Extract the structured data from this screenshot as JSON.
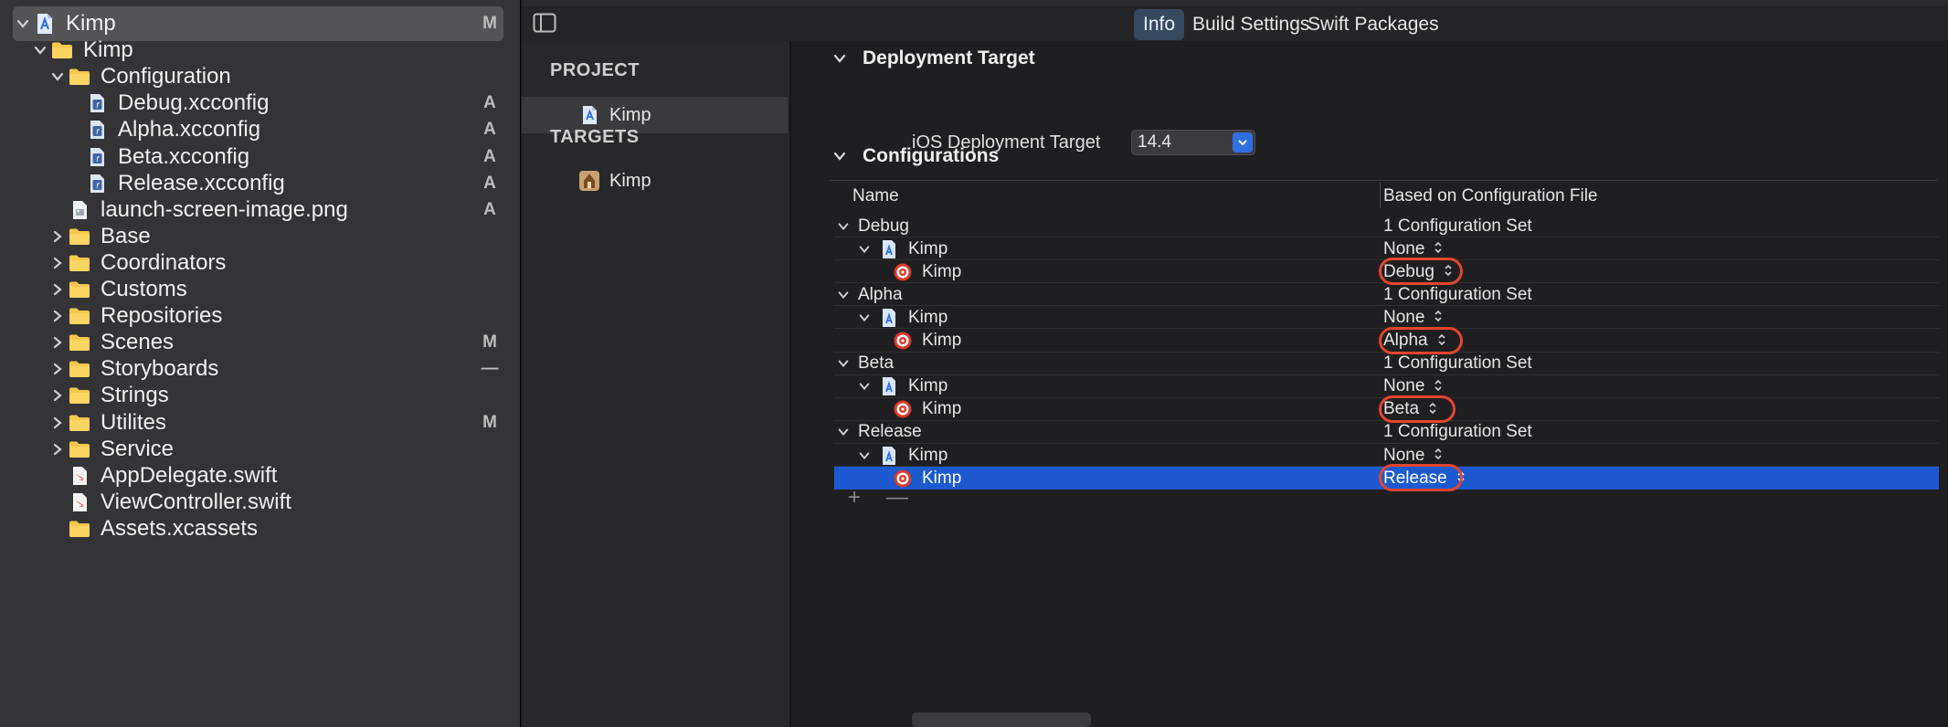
{
  "navigator": {
    "items": [
      {
        "label": "Kimp",
        "badge": "M",
        "kind": "project",
        "indent": 0,
        "disclosure": "open",
        "selected": true
      },
      {
        "label": "Kimp",
        "badge": "",
        "kind": "folder",
        "indent": 1,
        "disclosure": "open"
      },
      {
        "label": "Configuration",
        "badge": "",
        "kind": "folder",
        "indent": 2,
        "disclosure": "open"
      },
      {
        "label": "Debug.xcconfig",
        "badge": "A",
        "kind": "xcconfig",
        "indent": 3
      },
      {
        "label": "Alpha.xcconfig",
        "badge": "A",
        "kind": "xcconfig",
        "indent": 3
      },
      {
        "label": "Beta.xcconfig",
        "badge": "A",
        "kind": "xcconfig",
        "indent": 3
      },
      {
        "label": "Release.xcconfig",
        "badge": "A",
        "kind": "xcconfig",
        "indent": 3
      },
      {
        "label": "launch-screen-image.png",
        "badge": "A",
        "kind": "image",
        "indent": 2
      },
      {
        "label": "Base",
        "badge": "",
        "kind": "folder",
        "indent": 2,
        "disclosure": "closed"
      },
      {
        "label": "Coordinators",
        "badge": "",
        "kind": "folder",
        "indent": 2,
        "disclosure": "closed"
      },
      {
        "label": "Customs",
        "badge": "",
        "kind": "folder",
        "indent": 2,
        "disclosure": "closed"
      },
      {
        "label": "Repositories",
        "badge": "",
        "kind": "folder",
        "indent": 2,
        "disclosure": "closed"
      },
      {
        "label": "Scenes",
        "badge": "M",
        "kind": "folder",
        "indent": 2,
        "disclosure": "closed"
      },
      {
        "label": "Storyboards",
        "badge": "—",
        "kind": "folder",
        "indent": 2,
        "disclosure": "closed"
      },
      {
        "label": "Strings",
        "badge": "",
        "kind": "folder",
        "indent": 2,
        "disclosure": "closed"
      },
      {
        "label": "Utilites",
        "badge": "M",
        "kind": "folder",
        "indent": 2,
        "disclosure": "closed"
      },
      {
        "label": "Service",
        "badge": "",
        "kind": "folder",
        "indent": 2,
        "disclosure": "closed"
      },
      {
        "label": "AppDelegate.swift",
        "badge": "",
        "kind": "swift",
        "indent": 2
      },
      {
        "label": "ViewController.swift",
        "badge": "",
        "kind": "swift",
        "indent": 2
      },
      {
        "label": "Assets.xcassets",
        "badge": "",
        "kind": "folder",
        "indent": 2
      }
    ]
  },
  "tabs": {
    "info": "Info",
    "build_settings": "Build Settings",
    "swift_packages": "Swift Packages"
  },
  "project_list": {
    "project_header": "PROJECT",
    "project_item": "Kimp",
    "targets_header": "TARGETS",
    "target_item": "Kimp"
  },
  "deployment": {
    "header": "Deployment Target",
    "label": "iOS Deployment Target",
    "value": "14.4"
  },
  "configurations": {
    "header": "Configurations",
    "col_name": "Name",
    "col_file": "Based on Configuration File",
    "rows": [
      {
        "name": "Debug",
        "level": 0,
        "value": "1 Configuration Set"
      },
      {
        "name": "Kimp",
        "level": 1,
        "value": "None"
      },
      {
        "name": "Kimp",
        "level": 2,
        "value": "Debug",
        "circled": true
      },
      {
        "name": "Alpha",
        "level": 0,
        "value": "1 Configuration Set"
      },
      {
        "name": "Kimp",
        "level": 1,
        "value": "None"
      },
      {
        "name": "Kimp",
        "level": 2,
        "value": "Alpha",
        "circled": true
      },
      {
        "name": "Beta",
        "level": 0,
        "value": "1 Configuration Set"
      },
      {
        "name": "Kimp",
        "level": 1,
        "value": "None"
      },
      {
        "name": "Kimp",
        "level": 2,
        "value": "Beta",
        "circled": true
      },
      {
        "name": "Release",
        "level": 0,
        "value": "1 Configuration Set"
      },
      {
        "name": "Kimp",
        "level": 1,
        "value": "None"
      },
      {
        "name": "Kimp",
        "level": 2,
        "value": "Release",
        "circled": true,
        "selected": true
      }
    ],
    "add": "+",
    "remove": "—"
  },
  "colors": {
    "accent": "#1d5ad0",
    "folder": "#f5c84c",
    "annotation": "#e2452f"
  }
}
